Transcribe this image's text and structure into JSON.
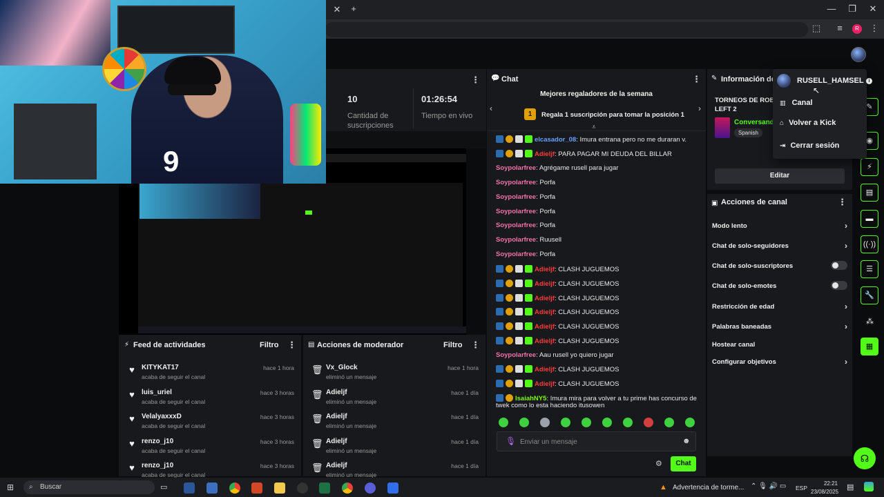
{
  "stats": {
    "subs_count": "10",
    "subs_label_1": "Cantidad de",
    "subs_label_2": "suscripciones",
    "live_time": "01:26:54",
    "live_label": "Tiempo en vivo"
  },
  "chat": {
    "title": "Chat",
    "gifters_title": "Mejores regaladores de la semana",
    "gifters_prompt": "Regala 1 suscripción para tomar la posición 1",
    "gifters_rank": "1",
    "messages": [
      {
        "user": "elcasador_08",
        "text": ": Imura entrana pero no me duraran v.",
        "style": "blue"
      },
      {
        "user": "Adieljf",
        "text": ": PARA PAGAR MI DEUDA DEL BILLAR",
        "style": "red"
      },
      {
        "user": "Soypolarfree",
        "text": ": Agrégame rusell para jugar",
        "style": "pink"
      },
      {
        "user": "Soypolarfree",
        "text": ": Porfa",
        "style": "pink"
      },
      {
        "user": "Soypolarfree",
        "text": ": Porfa",
        "style": "pink"
      },
      {
        "user": "Soypolarfree",
        "text": ": Porfa",
        "style": "pink"
      },
      {
        "user": "Soypolarfree",
        "text": ": Porfa",
        "style": "pink"
      },
      {
        "user": "Soypolarfree",
        "text": ": Ruusell",
        "style": "pink"
      },
      {
        "user": "Soypolarfree",
        "text": ": Porfa",
        "style": "pink"
      },
      {
        "user": "Adieljf",
        "text": ": CLASH JUGUEMOS",
        "style": "red"
      },
      {
        "user": "Adieljf",
        "text": ": CLASH JUGUEMOS",
        "style": "red"
      },
      {
        "user": "Adieljf",
        "text": ": CLASH JUGUEMOS",
        "style": "red"
      },
      {
        "user": "Adieljf",
        "text": ": CLASH JUGUEMOS",
        "style": "red"
      },
      {
        "user": "Adieljf",
        "text": ": CLASH JUGUEMOS",
        "style": "red"
      },
      {
        "user": "Adieljf",
        "text": ": CLASH JUGUEMOS",
        "style": "red"
      },
      {
        "user": "Soypolarfree",
        "text": ": Aau rusell yo quiero jugar",
        "style": "pink"
      },
      {
        "user": "Adieljf",
        "text": ": CLASH JUGUEMOS",
        "style": "red"
      },
      {
        "user": "Adieljf",
        "text": ": CLASH JUGUEMOS",
        "style": "red"
      },
      {
        "user": "IsaiahNY5",
        "text": ": Imura mira para volver a tu prime has concurso de",
        "style": "green"
      }
    ],
    "last_line_cont": "twek como lo esta haciendo itusowen",
    "input_placeholder": "Enviar un mensaje",
    "send_label": "Chat"
  },
  "feed": {
    "title": "Feed de actividades",
    "filter_label": "Filtro",
    "items": [
      {
        "name": "KITYKAT17",
        "sub": "acaba de seguir el canal",
        "time": "hace 1 hora"
      },
      {
        "name": "luis_uriel",
        "sub": "acaba de seguir el canal",
        "time": "hace 3 horas"
      },
      {
        "name": "VelalyaxxxD",
        "sub": "acaba de seguir el canal",
        "time": "hace 3 horas"
      },
      {
        "name": "renzo_j10",
        "sub": "acaba de seguir el canal",
        "time": "hace 3 horas"
      },
      {
        "name": "renzo_j10",
        "sub": "acaba de seguir el canal",
        "time": "hace 3 horas"
      }
    ]
  },
  "mod": {
    "title": "Acciones de moderador",
    "filter_label": "Filtro",
    "items": [
      {
        "name": "Vx_Glock",
        "sub": "eliminó un mensaje",
        "time": "hace 1 hora"
      },
      {
        "name": "Adieljf",
        "sub": "eliminó un mensaje",
        "time": "hace 1 día"
      },
      {
        "name": "Adieljf",
        "sub": "eliminó un mensaje",
        "time": "hace 1 día"
      },
      {
        "name": "Adieljf",
        "sub": "eliminó un mensaje",
        "time": "hace 1 día"
      },
      {
        "name": "Adieljf",
        "sub": "eliminó un mensaje",
        "time": "hace 1 día"
      }
    ]
  },
  "info": {
    "title": "Información del",
    "stream_title_1": "TORNEOS DE ROB",
    "stream_title_2": "LEFT 2",
    "category": "Conversand",
    "language": "Spanish",
    "edit_label": "Editar"
  },
  "actions": {
    "title": "Acciones de canal",
    "rows": [
      {
        "label": "Modo lento",
        "control": "chevron"
      },
      {
        "label": "Chat de solo-seguidores",
        "control": "chevron"
      },
      {
        "label": "Chat de solo-suscriptores",
        "control": "toggle"
      },
      {
        "label": "Chat de solo-emotes",
        "control": "toggle"
      },
      {
        "label": "Restricción de edad",
        "control": "chevron"
      },
      {
        "label": "Palabras baneadas",
        "control": "chevron"
      },
      {
        "label": "Hostear canal",
        "control": "none"
      },
      {
        "label": "Configurar objetivos",
        "control": "chevron"
      }
    ]
  },
  "menu": {
    "username": "RUSELL_HAMSEL",
    "items": [
      "Canal",
      "Volver a Kick",
      "Cerrar sesión"
    ]
  },
  "taskbar": {
    "search_label": "Buscar",
    "weather_label": "Advertencia de torme...",
    "lang": "ESP",
    "time": "22:21",
    "date": "23/08/2025"
  },
  "webcam": {
    "shirt_number": "9"
  },
  "colors": {
    "accent": "#53fc18",
    "panel": "#18191c",
    "background": "#0b0c0e"
  }
}
